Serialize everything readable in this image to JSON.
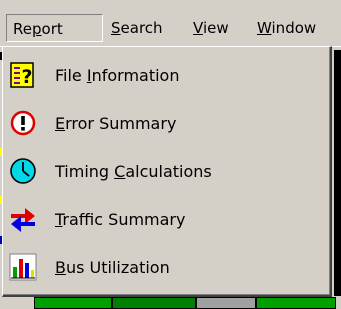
{
  "menubar": {
    "items": [
      {
        "label": "Report",
        "mnemonic_index": 2
      },
      {
        "label": "Search",
        "mnemonic_index": 0
      },
      {
        "label": "View",
        "mnemonic_index": 0
      },
      {
        "label": "Window",
        "mnemonic_index": 0
      }
    ]
  },
  "dropdown": {
    "items": [
      {
        "label": "File Information",
        "mnemonic_index": 5,
        "icon": "file-info-icon"
      },
      {
        "label": "Error Summary",
        "mnemonic_index": 0,
        "icon": "error-icon"
      },
      {
        "label": "Timing Calculations",
        "mnemonic_index": 7,
        "icon": "clock-icon"
      },
      {
        "label": "Traffic Summary",
        "mnemonic_index": 0,
        "icon": "traffic-arrows-icon"
      },
      {
        "label": "Bus Utilization",
        "mnemonic_index": 0,
        "icon": "bar-chart-icon"
      }
    ]
  },
  "colors": {
    "menu_bg": "#d4d0c8",
    "error_red": "#e00000",
    "clock_cyan": "#00d8e8",
    "arrow_red": "#e00000",
    "arrow_blue": "#0000e0"
  }
}
